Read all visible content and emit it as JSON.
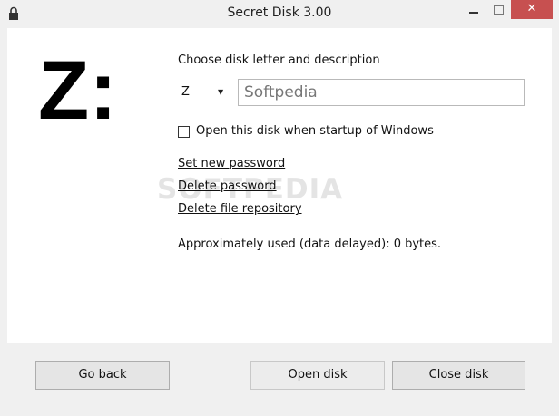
{
  "window": {
    "title": "Secret Disk 3.00",
    "close_glyph": "✕",
    "icon": "lock-icon"
  },
  "disk": {
    "letter_display": "Z:",
    "choose_label": "Choose disk letter and description",
    "letter": "Z",
    "description": "Softpedia",
    "startup_label": "Open this disk when startup of Windows",
    "startup_checked": false
  },
  "links": {
    "set_password": "Set new password",
    "delete_password": "Delete password",
    "delete_repository": "Delete file repository"
  },
  "usage_text": "Approximately used (data delayed): 0 bytes.",
  "watermark": "SOFTPEDIA",
  "buttons": {
    "go_back": "Go back",
    "open_disk": "Open disk",
    "close_disk": "Close disk"
  },
  "colors": {
    "close_button": "#c75050",
    "window_bg": "#f0f0f0",
    "client_bg": "#ffffff"
  }
}
